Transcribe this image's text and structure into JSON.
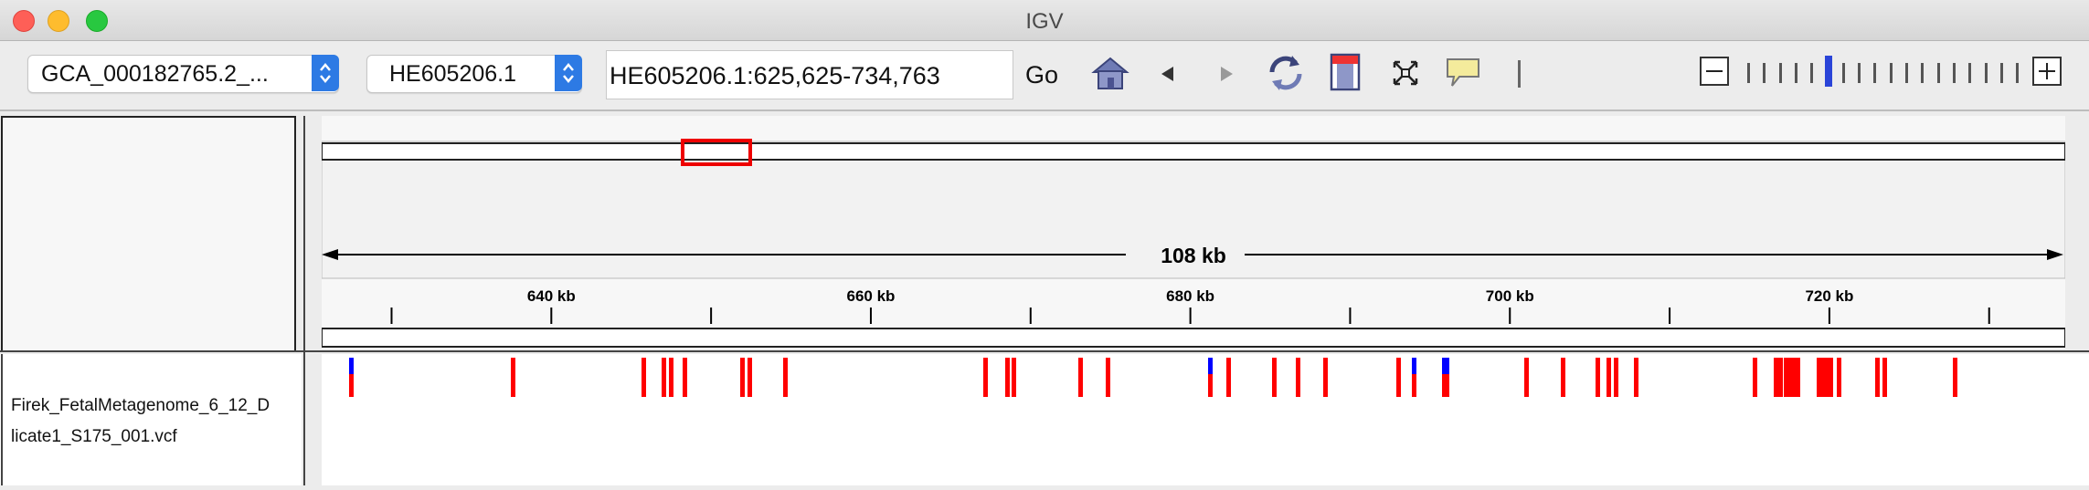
{
  "window": {
    "title": "IGV"
  },
  "toolbar": {
    "genome_value": "GCA_000182765.2_...",
    "chromosome_value": "HE605206.1",
    "locus_value": "HE605206.1:625,625-734,763",
    "go_label": "Go",
    "icons": [
      "home-icon",
      "back-arrow-icon",
      "forward-arrow-icon",
      "refresh-icon",
      "region-of-interest-icon",
      "resize-to-window-icon",
      "popup-info-icon",
      "divider-icon"
    ]
  },
  "zoom": {
    "levels": 18,
    "current_level": 5
  },
  "ruler": {
    "span_label": "108 kb",
    "tick_labels": [
      "640 kb",
      "660 kb",
      "680 kb",
      "700 kb",
      "720 kb"
    ],
    "view_start": 625625,
    "view_end": 734763
  },
  "track": {
    "name_line1": "Firek_FetalMetagenome_6_12_D",
    "name_line2": "licate1_S175_001.vcf",
    "variant_color": "#ff0000",
    "het_color": "#0000ff"
  }
}
